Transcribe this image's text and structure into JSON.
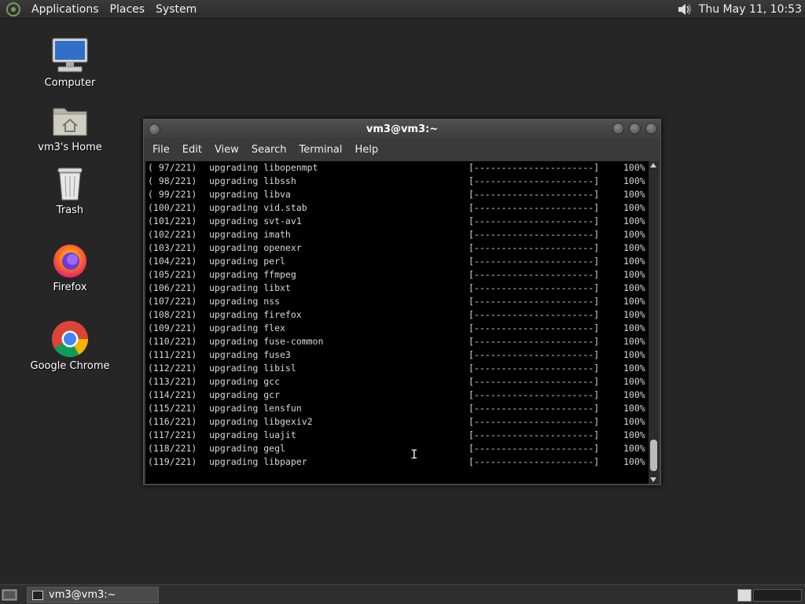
{
  "top_panel": {
    "menus": [
      "Applications",
      "Places",
      "System"
    ],
    "clock": "Thu May 11, 10:53"
  },
  "desktop": {
    "icons": [
      {
        "label": "Computer",
        "icon": "computer-icon"
      },
      {
        "label": "vm3's Home",
        "icon": "home-folder-icon"
      },
      {
        "label": "Trash",
        "icon": "trash-icon"
      },
      {
        "label": "Firefox",
        "icon": "firefox-icon"
      },
      {
        "label": "Google Chrome",
        "icon": "chrome-icon"
      }
    ]
  },
  "terminal": {
    "title": "vm3@vm3:~",
    "menu": [
      "File",
      "Edit",
      "View",
      "Search",
      "Terminal",
      "Help"
    ],
    "lines": [
      {
        "num": "( 97/221)",
        "text": "upgrading libopenmpt",
        "bar": "[----------------------]",
        "pct": "100%"
      },
      {
        "num": "( 98/221)",
        "text": "upgrading libssh",
        "bar": "[----------------------]",
        "pct": "100%"
      },
      {
        "num": "( 99/221)",
        "text": "upgrading libva",
        "bar": "[----------------------]",
        "pct": "100%"
      },
      {
        "num": "(100/221)",
        "text": "upgrading vid.stab",
        "bar": "[----------------------]",
        "pct": "100%"
      },
      {
        "num": "(101/221)",
        "text": "upgrading svt-av1",
        "bar": "[----------------------]",
        "pct": "100%"
      },
      {
        "num": "(102/221)",
        "text": "upgrading imath",
        "bar": "[----------------------]",
        "pct": "100%"
      },
      {
        "num": "(103/221)",
        "text": "upgrading openexr",
        "bar": "[----------------------]",
        "pct": "100%"
      },
      {
        "num": "(104/221)",
        "text": "upgrading perl",
        "bar": "[----------------------]",
        "pct": "100%"
      },
      {
        "num": "(105/221)",
        "text": "upgrading ffmpeg",
        "bar": "[----------------------]",
        "pct": "100%"
      },
      {
        "num": "(106/221)",
        "text": "upgrading libxt",
        "bar": "[----------------------]",
        "pct": "100%"
      },
      {
        "num": "(107/221)",
        "text": "upgrading nss",
        "bar": "[----------------------]",
        "pct": "100%"
      },
      {
        "num": "(108/221)",
        "text": "upgrading firefox",
        "bar": "[----------------------]",
        "pct": "100%"
      },
      {
        "num": "(109/221)",
        "text": "upgrading flex",
        "bar": "[----------------------]",
        "pct": "100%"
      },
      {
        "num": "(110/221)",
        "text": "upgrading fuse-common",
        "bar": "[----------------------]",
        "pct": "100%"
      },
      {
        "num": "(111/221)",
        "text": "upgrading fuse3",
        "bar": "[----------------------]",
        "pct": "100%"
      },
      {
        "num": "(112/221)",
        "text": "upgrading libisl",
        "bar": "[----------------------]",
        "pct": "100%"
      },
      {
        "num": "(113/221)",
        "text": "upgrading gcc",
        "bar": "[----------------------]",
        "pct": "100%"
      },
      {
        "num": "(114/221)",
        "text": "upgrading gcr",
        "bar": "[----------------------]",
        "pct": "100%"
      },
      {
        "num": "(115/221)",
        "text": "upgrading lensfun",
        "bar": "[----------------------]",
        "pct": "100%"
      },
      {
        "num": "(116/221)",
        "text": "upgrading libgexiv2",
        "bar": "[----------------------]",
        "pct": "100%"
      },
      {
        "num": "(117/221)",
        "text": "upgrading luajit",
        "bar": "[----------------------]",
        "pct": "100%"
      },
      {
        "num": "(118/221)",
        "text": "upgrading gegl",
        "bar": "[----------------------]",
        "pct": "100%"
      },
      {
        "num": "(119/221)",
        "text": "upgrading libpaper",
        "bar": "[----------------------]",
        "pct": "100%"
      }
    ]
  },
  "taskbar": {
    "task_label": "vm3@vm3:~"
  }
}
